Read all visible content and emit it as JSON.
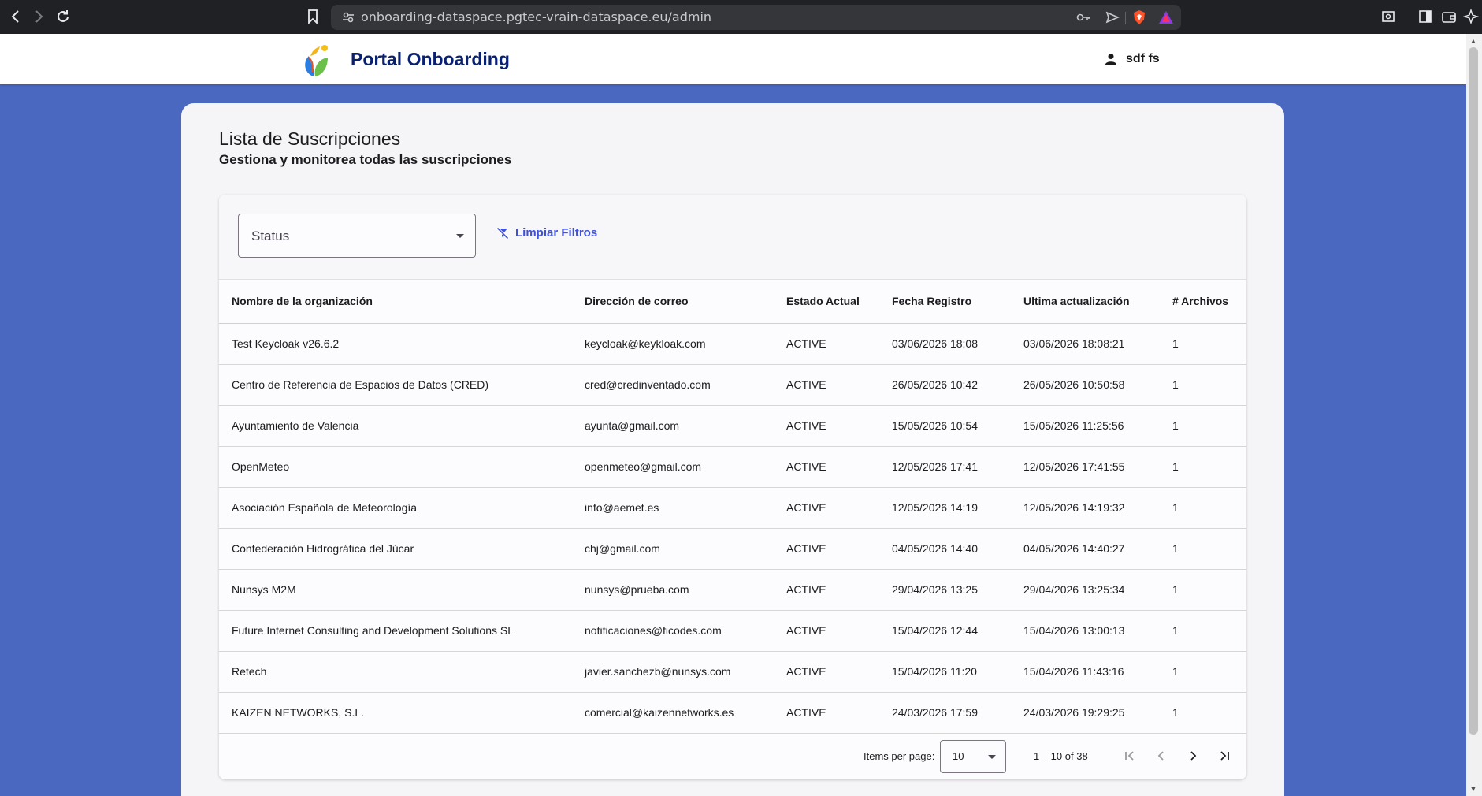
{
  "browser": {
    "url": "onboarding-dataspace.pgtec-vrain-dataspace.eu/admin"
  },
  "header": {
    "title": "Portal Onboarding",
    "user_name": "sdf fs"
  },
  "page": {
    "title": "Lista de Suscripciones",
    "subtitle": "Gestiona y monitorea todas las suscripciones"
  },
  "filters": {
    "status_label": "Status",
    "clear_label": "Limpiar Filtros"
  },
  "table": {
    "columns": [
      "Nombre de la organización",
      "Dirección de correo",
      "Estado Actual",
      "Fecha Registro",
      "Ultima actualización",
      "# Archivos"
    ],
    "rows": [
      [
        "Test Keycloak v26.6.2",
        "keycloak@keykloak.com",
        "ACTIVE",
        "03/06/2026 18:08",
        "03/06/2026 18:08:21",
        "1"
      ],
      [
        "Centro de Referencia de Espacios de Datos (CRED)",
        "cred@credinventado.com",
        "ACTIVE",
        "26/05/2026 10:42",
        "26/05/2026 10:50:58",
        "1"
      ],
      [
        "Ayuntamiento de Valencia",
        "ayunta@gmail.com",
        "ACTIVE",
        "15/05/2026 10:54",
        "15/05/2026 11:25:56",
        "1"
      ],
      [
        "OpenMeteo",
        "openmeteo@gmail.com",
        "ACTIVE",
        "12/05/2026 17:41",
        "12/05/2026 17:41:55",
        "1"
      ],
      [
        "Asociación Española de Meteorología",
        "info@aemet.es",
        "ACTIVE",
        "12/05/2026 14:19",
        "12/05/2026 14:19:32",
        "1"
      ],
      [
        "Confederación Hidrográfica del Júcar",
        "chj@gmail.com",
        "ACTIVE",
        "04/05/2026 14:40",
        "04/05/2026 14:40:27",
        "1"
      ],
      [
        "Nunsys M2M",
        "nunsys@prueba.com",
        "ACTIVE",
        "29/04/2026 13:25",
        "29/04/2026 13:25:34",
        "1"
      ],
      [
        "Future Internet Consulting and Development Solutions SL",
        "notificaciones@ficodes.com",
        "ACTIVE",
        "15/04/2026 12:44",
        "15/04/2026 13:00:13",
        "1"
      ],
      [
        "Retech",
        "javier.sanchezb@nunsys.com",
        "ACTIVE",
        "15/04/2026 11:20",
        "15/04/2026 11:43:16",
        "1"
      ],
      [
        "KAIZEN NETWORKS, S.L.",
        "comercial@kaizennetworks.es",
        "ACTIVE",
        "24/03/2026 17:59",
        "24/03/2026 19:29:25",
        "1"
      ]
    ]
  },
  "paginator": {
    "items_per_page_label": "Items per page:",
    "items_per_page_value": "10",
    "range_label": "1 – 10 of 38"
  },
  "colors": {
    "background": "#4a68c0",
    "title": "#0a2170",
    "link": "#3f51d8"
  }
}
